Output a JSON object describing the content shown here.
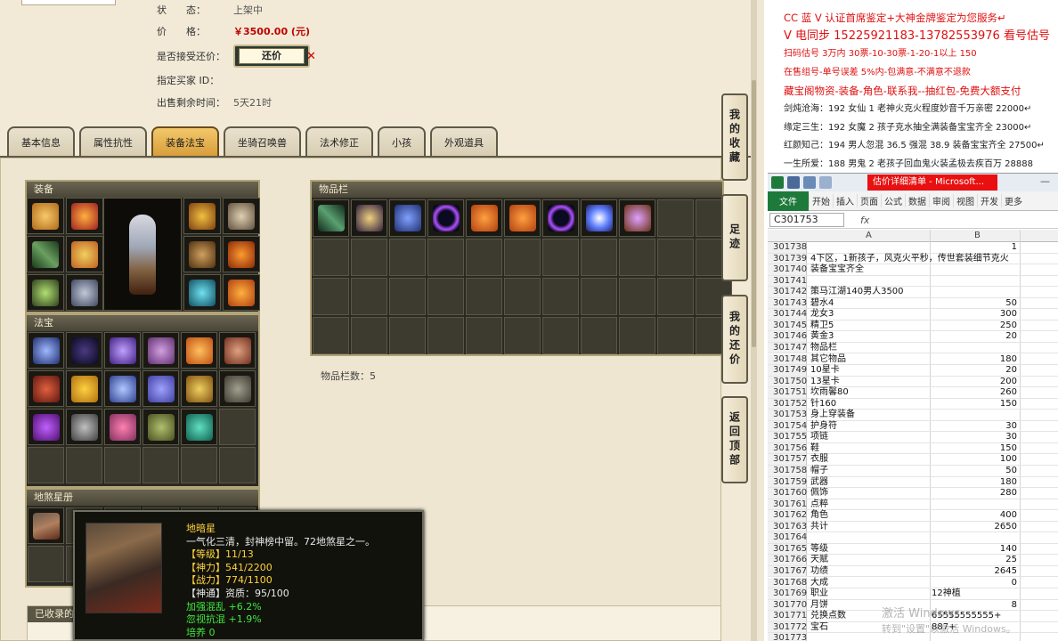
{
  "listing": {
    "status_label": "状　　态：",
    "status_value": "上架中",
    "price_label": "价　　格：",
    "price_value": "￥3500.00 (元)",
    "haggle_label": "是否接受还价：",
    "haggle_button": "还价",
    "buyer_label": "指定买家 ID：",
    "buyer_value": "",
    "remain_label": "出售剩余时间：",
    "remain_value": "5天21时"
  },
  "tabs": [
    "基本信息",
    "属性抗性",
    "装备法宝",
    "坐骑召唤兽",
    "法术修正",
    "小孩",
    "外观道具"
  ],
  "active_tab": "装备法宝",
  "panels": {
    "equip": "装备",
    "treasure": "法宝",
    "star": "地煞星册",
    "inventory": "物品栏",
    "collected": "已收录的"
  },
  "inventory_count": "物品栏数：5",
  "side_nav": [
    "我的收藏",
    "足迹",
    "我的还价",
    "返回顶部"
  ],
  "tooltip": {
    "name": "地暗星",
    "desc": "一气化三清，封神榜中留。72地煞星之一。",
    "lines": [
      {
        "text": "【等级】11/13",
        "color": "yellow"
      },
      {
        "text": "【神力】541/2200",
        "color": "yellow"
      },
      {
        "text": "【战力】774/1100",
        "color": "yellow"
      },
      {
        "text": "【神通】资质：95/100",
        "color": "mixed"
      },
      {
        "text": "加强混乱 +6.2%",
        "color": "green"
      },
      {
        "text": "忽视抗混 +1.9%",
        "color": "green"
      },
      {
        "text": "培养 0",
        "color": "green"
      }
    ]
  },
  "notes": [
    {
      "text": "CC 蓝 V 认证首席鉴定+大神金牌鉴定为您服务↵",
      "color": "#e01010"
    },
    {
      "text": "V 电同步 15225921183-13782553976 看号估号",
      "color": "#e01010"
    },
    {
      "text": "扫码估号 3万内 30票-10-30票-1-20-1以上 150",
      "color": "#e01010"
    },
    {
      "text": "在售组号-单号误差 5%内-包满意-不满意不退款",
      "color": "#e01010"
    },
    {
      "text": "藏宝阁物资-装备-角色-联系我--抽红包-免费大额支付",
      "color": "#e01010"
    },
    {
      "text": "剑炖沧海：192 女仙 1 老神火克火程度妙音千万亲密 22000↵",
      "color": "#222"
    },
    {
      "text": "缘定三生：192 女魔 2 孩子克水抽全满装备宝宝齐全 23000↵",
      "color": "#222"
    },
    {
      "text": "红颜知己：194 男人忽混 36.5 强混 38.9 装备宝宝齐全 27500↵",
      "color": "#222"
    },
    {
      "text": "一生所爱：188 男鬼 2 老孩子回血鬼火装孟极去疾百万 28888",
      "color": "#222"
    }
  ],
  "excel": {
    "window_title": "估价详细清单 - Microsoft...",
    "ribbon_file": "文件",
    "ribbon_tabs": [
      "开始",
      "插入",
      "页面",
      "公式",
      "数据",
      "审阅",
      "视图",
      "开发",
      "更多"
    ],
    "name_box": "C301753",
    "fx": "fx",
    "col_a": "A",
    "col_b": "B",
    "rows": [
      {
        "n": "301738",
        "a": "",
        "b": "1"
      },
      {
        "n": "301739",
        "a": "4下区，1新孩子，风克火平秒，传世套装细节克火",
        "b": ""
      },
      {
        "n": "301740",
        "a": "装备宝宝齐全",
        "b": ""
      },
      {
        "n": "301741",
        "a": "",
        "b": ""
      },
      {
        "n": "301742",
        "a": "策马江湖140男人3500",
        "b": ""
      },
      {
        "n": "301743",
        "a": "碧水4",
        "b": "50"
      },
      {
        "n": "301744",
        "a": "龙女3",
        "b": "300"
      },
      {
        "n": "301745",
        "a": "精卫5",
        "b": "250"
      },
      {
        "n": "301746",
        "a": "黄金3",
        "b": "20"
      },
      {
        "n": "301747",
        "a": "物品栏",
        "b": ""
      },
      {
        "n": "301748",
        "a": "其它物品",
        "b": "180"
      },
      {
        "n": "301749",
        "a": "10星卡",
        "b": "20"
      },
      {
        "n": "301750",
        "a": "13星卡",
        "b": "200"
      },
      {
        "n": "301751",
        "a": "坎雨馨80",
        "b": "260"
      },
      {
        "n": "301752",
        "a": "针160",
        "b": "150"
      },
      {
        "n": "301753",
        "a": "身上穿装备",
        "b": ""
      },
      {
        "n": "301754",
        "a": "护身符",
        "b": "30"
      },
      {
        "n": "301755",
        "a": "项链",
        "b": "30"
      },
      {
        "n": "301756",
        "a": "鞋",
        "b": "150"
      },
      {
        "n": "301757",
        "a": "衣服",
        "b": "100"
      },
      {
        "n": "301758",
        "a": "帽子",
        "b": "50"
      },
      {
        "n": "301759",
        "a": "武器",
        "b": "180"
      },
      {
        "n": "301760",
        "a": "佩饰",
        "b": "280"
      },
      {
        "n": "301761",
        "a": "点粹",
        "b": ""
      },
      {
        "n": "301762",
        "a": "角色",
        "b": "400"
      },
      {
        "n": "301763",
        "a": "共计",
        "b": "2650"
      },
      {
        "n": "301764",
        "a": "",
        "b": ""
      },
      {
        "n": "301765",
        "a": "等级",
        "b": "140"
      },
      {
        "n": "301766",
        "a": "天赋",
        "b": "25"
      },
      {
        "n": "301767",
        "a": "功绩",
        "b": "2645"
      },
      {
        "n": "301768",
        "a": "大成",
        "b": "0"
      },
      {
        "n": "301769",
        "a": "职业",
        "b": "12神植"
      },
      {
        "n": "301770",
        "a": "月饼",
        "b": "8"
      },
      {
        "n": "301771",
        "a": "兑换点数",
        "b": "65555555555+"
      },
      {
        "n": "301772",
        "a": "宝石",
        "b": "887+"
      },
      {
        "n": "301773",
        "a": "",
        "b": ""
      }
    ],
    "watermark": "激活 Windows",
    "watermark_sub": "转到\"设置\"以激活 Windows。"
  },
  "colors": {
    "price_red": "#c00000",
    "tab_active": "#e0a848",
    "tooltip_yellow": "#ffd23c",
    "tooltip_green": "#3ee83e",
    "excel_green": "#1e7a3a"
  }
}
